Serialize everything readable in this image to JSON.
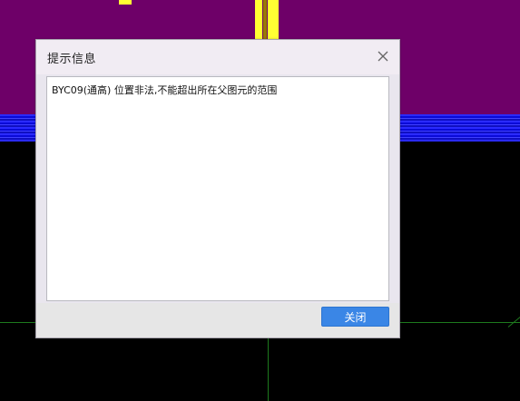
{
  "dialog": {
    "title": "提示信息",
    "message": "BYC09(通高) 位置非法,不能超出所在父图元的范围",
    "close_button_label": "关闭"
  },
  "icons": {
    "close": "close-icon"
  },
  "colors": {
    "canvas_background": "#000000",
    "purple_fill": "#6e0068",
    "blue_band": "#2a2aff",
    "yellow_element": "#ffff33",
    "grid_line": "#1e7a1e",
    "dialog_background": "#e9e6ee",
    "button_blue": "#3a86e6"
  }
}
